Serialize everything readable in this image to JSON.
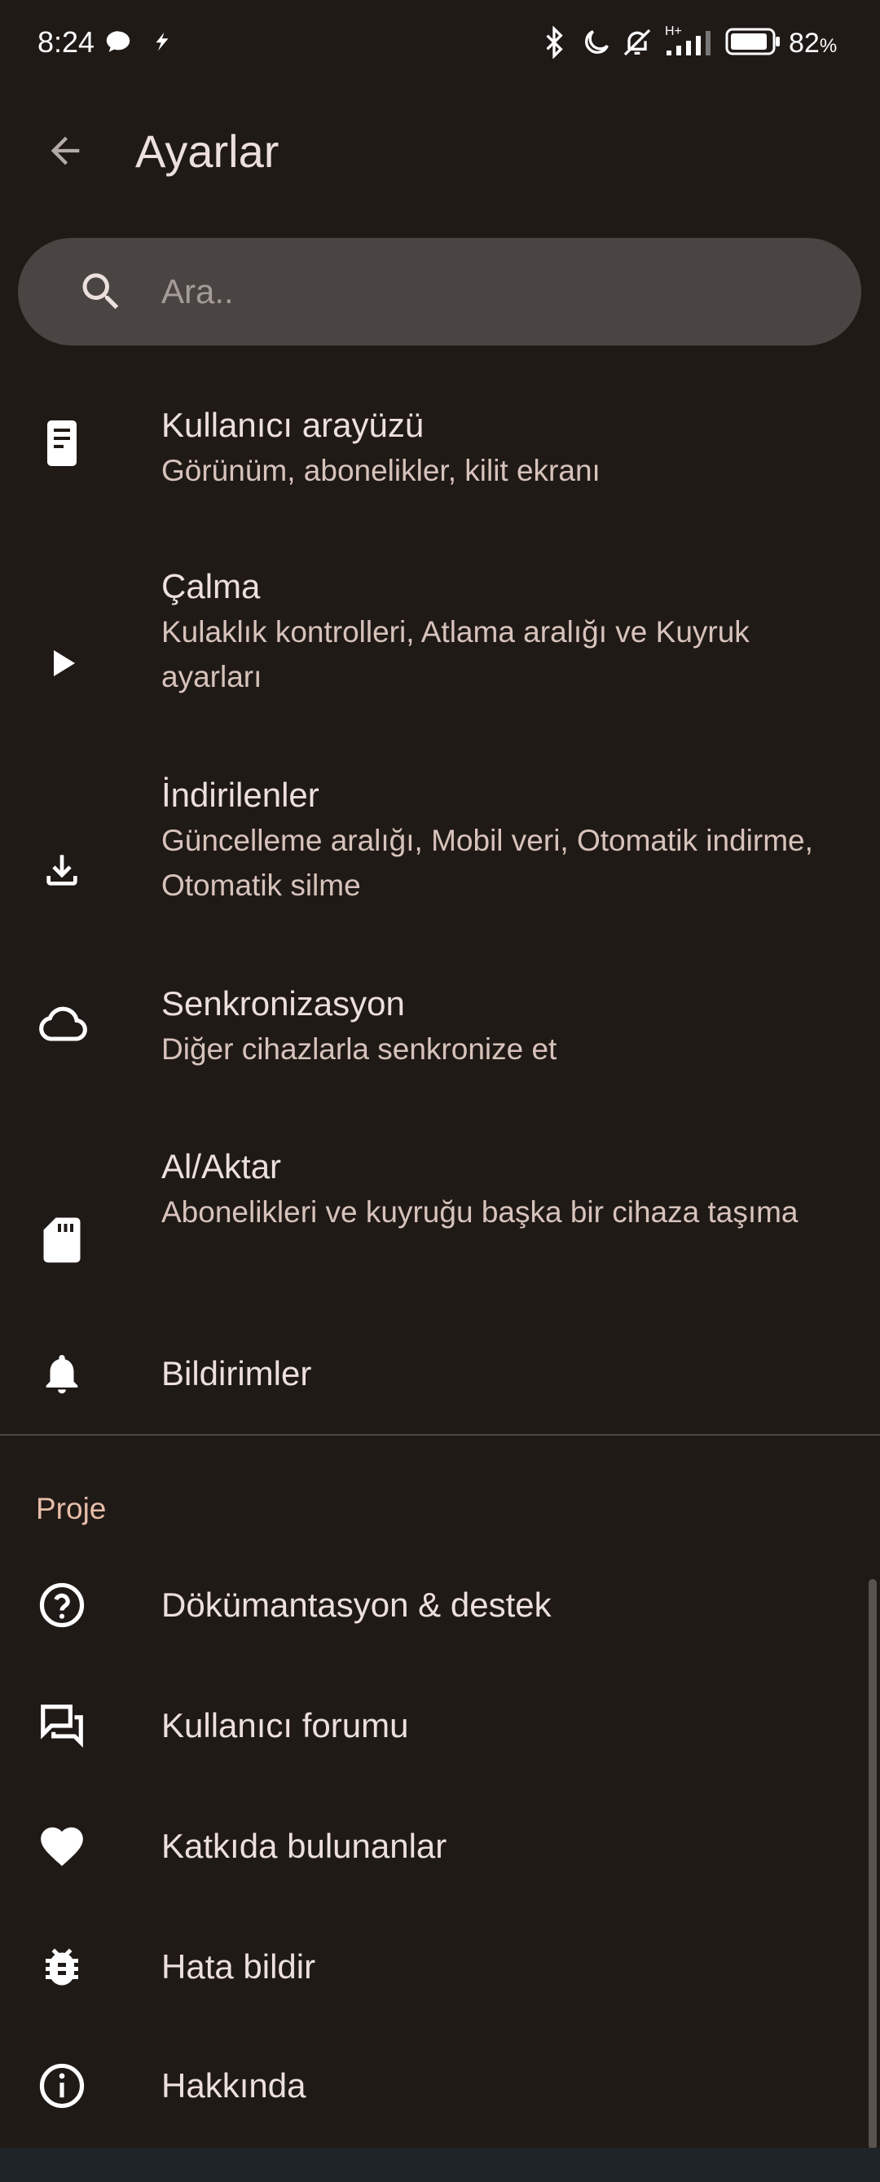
{
  "status_bar": {
    "time": "8:24",
    "battery_percent": "82",
    "battery_percent_sign": "%",
    "network_label": "H+",
    "icons": [
      "chat-bubble-icon",
      "app-notification-icon",
      "bluetooth-icon",
      "do-not-disturb-moon-icon",
      "muted-bell-icon",
      "signal-icon",
      "battery-icon"
    ]
  },
  "app_bar": {
    "title": "Ayarlar",
    "back_icon": "arrow-back-icon"
  },
  "search": {
    "placeholder": "Ara..",
    "value": "",
    "icon": "search-icon"
  },
  "settings": [
    {
      "title": "Kullanıcı arayüzü",
      "subtitle": "Görünüm, abonelikler, kilit ekranı",
      "icon": "phone-document-icon"
    },
    {
      "title": "Çalma",
      "subtitle": "Kulaklık kontrolleri, Atlama aralığı ve Kuyruk ayarları",
      "icon": "play-icon"
    },
    {
      "title": "İndirilenler",
      "subtitle": "Güncelleme aralığı, Mobil veri, Otomatik indirme, Otomatik silme",
      "icon": "download-icon"
    },
    {
      "title": "Senkronizasyon",
      "subtitle": "Diğer cihazlarla senkronize et",
      "icon": "cloud-icon"
    },
    {
      "title": "Al/Aktar",
      "subtitle": "Abonelikleri ve kuyruğu başka bir cihaza taşıma",
      "icon": "sd-card-icon"
    },
    {
      "title": "Bildirimler",
      "icon": "bell-icon"
    }
  ],
  "project_section": {
    "header": "Proje",
    "items": [
      {
        "title": "Dökümantasyon & destek",
        "icon": "help-circle-icon"
      },
      {
        "title": "Kullanıcı forumu",
        "icon": "forum-icon"
      },
      {
        "title": "Katkıda bulunanlar",
        "icon": "heart-icon"
      },
      {
        "title": "Hata bildir",
        "icon": "bug-icon"
      },
      {
        "title": "Hakkında",
        "icon": "info-icon"
      }
    ]
  },
  "colors": {
    "background": "#201a17",
    "text_primary": "#ede0dc",
    "text_secondary": "#d7c3bb",
    "section_accent": "#e7bda8",
    "search_bg": "#4a4542"
  }
}
